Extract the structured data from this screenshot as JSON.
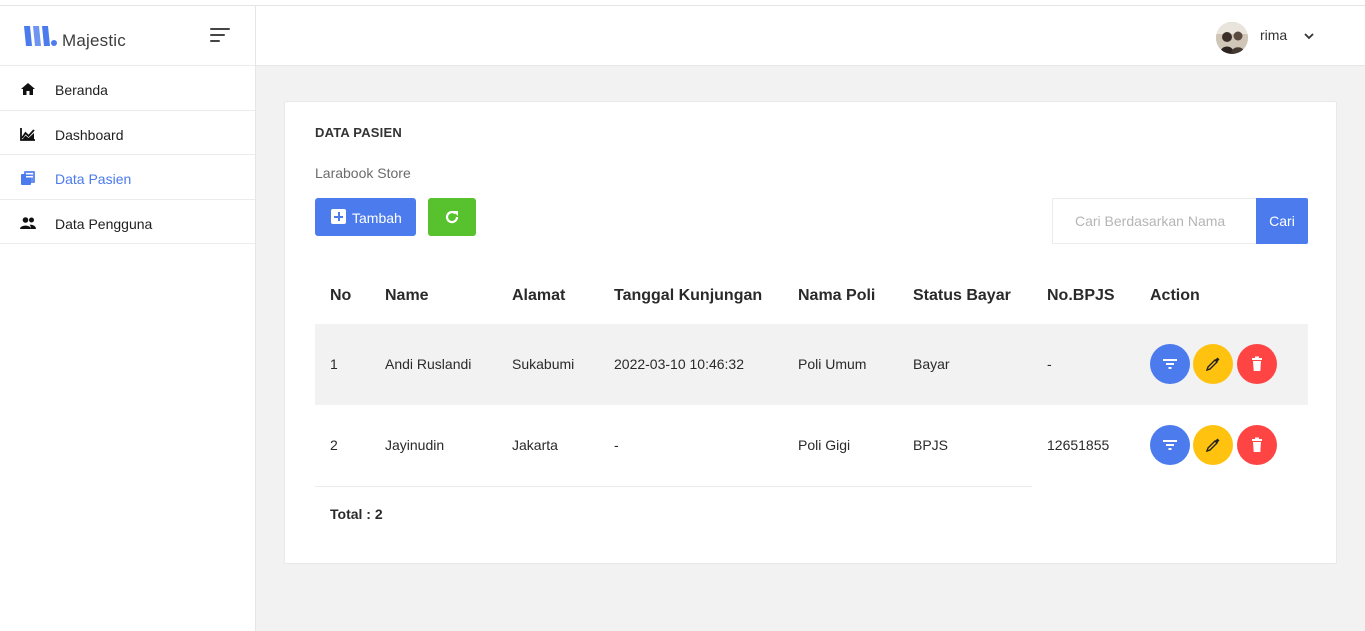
{
  "app": {
    "brand": "Majestic"
  },
  "sidebar": {
    "items": [
      {
        "label": "Beranda",
        "icon": "home-icon"
      },
      {
        "label": "Dashboard",
        "icon": "chart-icon"
      },
      {
        "label": "Data Pasien",
        "icon": "documents-icon",
        "active": true
      },
      {
        "label": "Data Pengguna",
        "icon": "users-icon"
      }
    ]
  },
  "navbar": {
    "username": "rima"
  },
  "card": {
    "title": "DATA PASIEN",
    "subtitle": "Larabook Store",
    "add_label": "Tambah",
    "search_placeholder": "Cari Berdasarkan Nama",
    "search_button": "Cari"
  },
  "table": {
    "headers": [
      "No",
      "Name",
      "Alamat",
      "Tanggal Kunjungan",
      "Nama Poli",
      "Status Bayar",
      "No.BPJS",
      "Action"
    ],
    "rows": [
      {
        "no": "1",
        "name": "Andi Ruslandi",
        "alamat": "Sukabumi",
        "tanggal": "2022-03-10 10:46:32",
        "poli": "Poli Umum",
        "status": "Bayar",
        "bpjs": "-"
      },
      {
        "no": "2",
        "name": "Jayinudin",
        "alamat": "Jakarta",
        "tanggal": "-",
        "poli": "Poli Gigi",
        "status": "BPJS",
        "bpjs": "12651855"
      }
    ],
    "total": "Total : 2"
  },
  "colors": {
    "primary": "#4b7bec",
    "success": "#57c22d",
    "warning": "#ffc20e",
    "danger": "#ff4444"
  }
}
